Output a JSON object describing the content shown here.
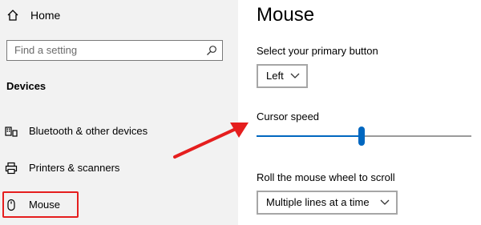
{
  "sidebar": {
    "home_label": "Home",
    "search_placeholder": "Find a setting",
    "section_title": "Devices",
    "items": [
      {
        "label": "Bluetooth & other devices",
        "icon": "bluetooth-devices-icon"
      },
      {
        "label": "Printers & scanners",
        "icon": "printer-icon"
      },
      {
        "label": "Mouse",
        "icon": "mouse-icon",
        "selected": true
      }
    ]
  },
  "main": {
    "title": "Mouse",
    "primary_button": {
      "label": "Select your primary button",
      "value": "Left"
    },
    "cursor_speed": {
      "label": "Cursor speed",
      "value_fraction": 0.49
    },
    "wheel_scroll": {
      "label": "Roll the mouse wheel to scroll",
      "value": "Multiple lines at a time"
    }
  },
  "annotation": {
    "color": "#e51e1e",
    "accent": "#0067c0"
  }
}
